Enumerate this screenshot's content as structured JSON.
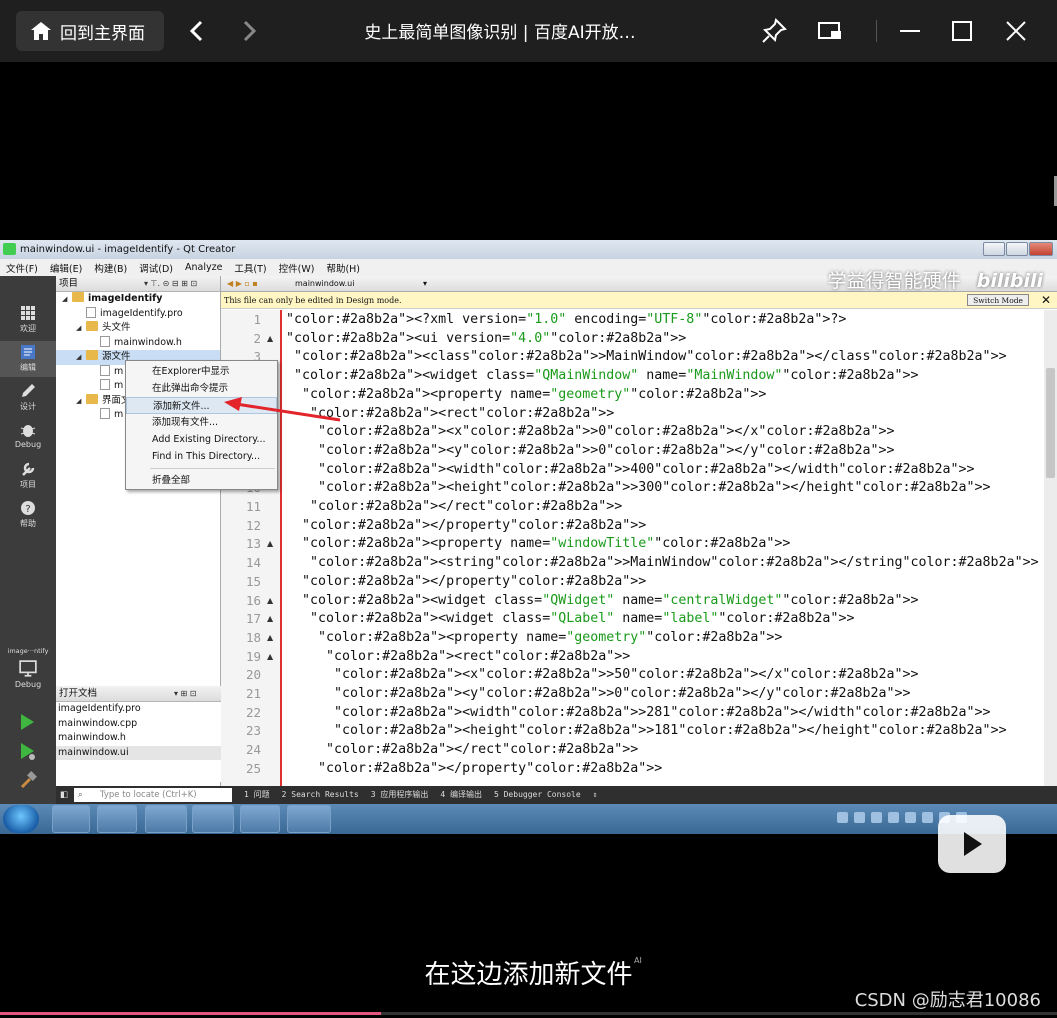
{
  "browser": {
    "home_label": "回到主界面",
    "title": "史上最简单图像识别 | 百度AI开放…",
    "icons": [
      "home-icon",
      "back-arrow-icon",
      "forward-arrow-icon",
      "pin-icon",
      "picture-in-picture-icon",
      "minimize-icon",
      "maximize-icon",
      "close-icon"
    ]
  },
  "qt": {
    "window_title": "mainwindow.ui - imageIdentify - Qt Creator",
    "menu": [
      "文件(F)",
      "编辑(E)",
      "构建(B)",
      "调试(D)",
      "Analyze",
      "工具(T)",
      "控件(W)",
      "帮助(H)"
    ],
    "modes": [
      {
        "label": "欢迎",
        "icon": "grid-icon"
      },
      {
        "label": "编辑",
        "icon": "edit-icon",
        "active": true
      },
      {
        "label": "设计",
        "icon": "pen-icon"
      },
      {
        "label": "Debug",
        "icon": "bug-icon"
      },
      {
        "label": "项目",
        "icon": "wrench-icon"
      },
      {
        "label": "帮助",
        "icon": "help-icon"
      }
    ],
    "kit_label": "image···ntify",
    "kit_mode": "Debug",
    "project_pane": {
      "header": "项目",
      "tree": [
        {
          "label": "imageIdentify",
          "level": 0,
          "type": "project"
        },
        {
          "label": "imageIdentify.pro",
          "level": 1,
          "type": "file"
        },
        {
          "label": "头文件",
          "level": 1,
          "type": "folder"
        },
        {
          "label": "mainwindow.h",
          "level": 2,
          "type": "file"
        },
        {
          "label": "源文件",
          "level": 1,
          "type": "folder"
        },
        {
          "label": "m",
          "level": 2,
          "type": "file"
        },
        {
          "label": "m",
          "level": 2,
          "type": "file"
        },
        {
          "label": "界面文",
          "level": 1,
          "type": "folder"
        },
        {
          "label": "m",
          "level": 2,
          "type": "file"
        }
      ]
    },
    "context_menu": {
      "items": [
        "在Explorer中显示",
        "在此弹出命令提示",
        "添加新文件...",
        "添加现有文件...",
        "Add Existing Directory...",
        "Find in This Directory...",
        "折叠全部"
      ],
      "highlighted": "添加新文件..."
    },
    "open_docs": {
      "header": "打开文档",
      "items": [
        "imageIdentify.pro",
        "mainwindow.cpp",
        "mainwindow.h",
        "mainwindow.ui"
      ],
      "selected": "mainwindow.ui"
    },
    "editor": {
      "tab": "mainwindow.ui",
      "info": "This file can only be edited in Design mode.",
      "switch_mode": "Switch Mode",
      "lines": [
        {
          "n": "1",
          "fold": "",
          "text": "<?xml version=\"1.0\" encoding=\"UTF-8\"?>"
        },
        {
          "n": "2",
          "fold": "▲",
          "text": "<ui version=\"4.0\">"
        },
        {
          "n": "3",
          "fold": "",
          "text": " <class>MainWindow</class>"
        },
        {
          "n": "4",
          "fold": "▲",
          "text": " <widget class=\"QMainWindow\" name=\"MainWindow\">"
        },
        {
          "n": "5",
          "fold": "▲",
          "text": "  <property name=\"geometry\">"
        },
        {
          "n": "6",
          "fold": "▲",
          "text": "   <rect>"
        },
        {
          "n": "7",
          "fold": "",
          "text": "    <x>0</x>"
        },
        {
          "n": "8",
          "fold": "",
          "text": "    <y>0</y>"
        },
        {
          "n": "9",
          "fold": "",
          "text": "    <width>400</width>"
        },
        {
          "n": "10",
          "fold": "",
          "text": "    <height>300</height>"
        },
        {
          "n": "11",
          "fold": "",
          "text": "   </rect>"
        },
        {
          "n": "12",
          "fold": "",
          "text": "  </property>"
        },
        {
          "n": "13",
          "fold": "▲",
          "text": "  <property name=\"windowTitle\">"
        },
        {
          "n": "14",
          "fold": "",
          "text": "   <string>MainWindow</string>"
        },
        {
          "n": "15",
          "fold": "",
          "text": "  </property>"
        },
        {
          "n": "16",
          "fold": "▲",
          "text": "  <widget class=\"QWidget\" name=\"centralWidget\">"
        },
        {
          "n": "17",
          "fold": "▲",
          "text": "   <widget class=\"QLabel\" name=\"label\">"
        },
        {
          "n": "18",
          "fold": "▲",
          "text": "    <property name=\"geometry\">"
        },
        {
          "n": "19",
          "fold": "▲",
          "text": "     <rect>"
        },
        {
          "n": "20",
          "fold": "",
          "text": "      <x>50</x>"
        },
        {
          "n": "21",
          "fold": "",
          "text": "      <y>0</y>"
        },
        {
          "n": "22",
          "fold": "",
          "text": "      <width>281</width>"
        },
        {
          "n": "23",
          "fold": "",
          "text": "      <height>181</height>"
        },
        {
          "n": "24",
          "fold": "",
          "text": "     </rect>"
        },
        {
          "n": "25",
          "fold": "",
          "text": "    </property>"
        }
      ]
    },
    "output_bar": {
      "locate_placeholder": "Type to locate (Ctrl+K)",
      "tabs": [
        "1 问题",
        "2 Search Results",
        "3 应用程序输出",
        "4 编译输出",
        "5 Debugger Console"
      ]
    }
  },
  "watermark": "学益得智能硬件",
  "bilibili_logo": "bilibili",
  "subtitle": "在这边添加新文件",
  "ai_mark": "AI",
  "csdn": "CSDN @励志君10086",
  "progress": 0.36
}
